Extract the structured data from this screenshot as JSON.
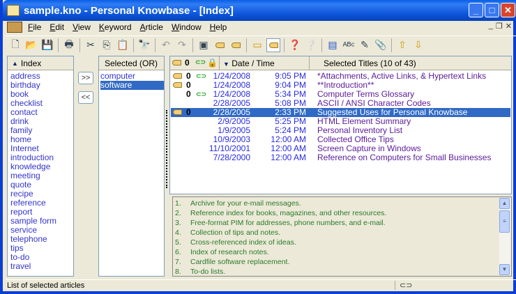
{
  "window": {
    "title": "sample.kno - Personal Knowbase - [Index]"
  },
  "menu": [
    "File",
    "Edit",
    "View",
    "Keyword",
    "Article",
    "Window",
    "Help"
  ],
  "keywords": {
    "header": "Index",
    "items": [
      "address",
      "birthday",
      "book",
      "checklist",
      "contact",
      "drink",
      "family",
      "home",
      "Internet",
      "introduction",
      "knowledge",
      "meeting",
      "quote",
      "recipe",
      "reference",
      "report",
      "sample form",
      "service",
      "telephone",
      "tips",
      "to-do",
      "travel"
    ]
  },
  "buttons": {
    "add": ">>",
    "remove": "<<"
  },
  "selected": {
    "header": "Selected (OR)",
    "items": [
      "computer",
      "software"
    ],
    "selected_index": 1
  },
  "articles": {
    "date_header": "Date / Time",
    "titles_header": "Selected Titles (10 of 43)",
    "rows": [
      {
        "tag": true,
        "clip": true,
        "link": true,
        "date": "1/24/2008",
        "time": "9:05 PM",
        "title": "*Attachments, Active Links, & Hypertext Links"
      },
      {
        "tag": true,
        "clip": true,
        "link": false,
        "date": "1/24/2008",
        "time": "9:04 PM",
        "title": "**Introduction**"
      },
      {
        "tag": false,
        "clip": true,
        "link": true,
        "date": "1/24/2008",
        "time": "5:34 PM",
        "title": "Computer Terms Glossary"
      },
      {
        "tag": false,
        "clip": false,
        "link": false,
        "date": "2/28/2005",
        "time": "5:08 PM",
        "title": "ASCII / ANSI Character Codes"
      },
      {
        "tag": true,
        "clip": true,
        "link": false,
        "date": "2/28/2005",
        "time": "2:33 PM",
        "title": "Suggested Uses for Personal Knowbase",
        "selected": true
      },
      {
        "tag": false,
        "clip": false,
        "link": false,
        "date": "2/9/2005",
        "time": "5:25 PM",
        "title": "HTML Element Summary"
      },
      {
        "tag": false,
        "clip": false,
        "link": false,
        "date": "1/9/2005",
        "time": "5:24 PM",
        "title": "Personal Inventory List"
      },
      {
        "tag": false,
        "clip": false,
        "link": false,
        "date": "10/9/2003",
        "time": "12:00 AM",
        "title": "Collected Office Tips"
      },
      {
        "tag": false,
        "clip": false,
        "link": false,
        "date": "11/10/2001",
        "time": "12:00 AM",
        "title": "Screen Capture in Windows"
      },
      {
        "tag": false,
        "clip": false,
        "link": false,
        "date": "7/28/2000",
        "time": "12:00 AM",
        "title": "Reference on Computers for Small Businesses"
      }
    ]
  },
  "preview": [
    "1.|Archive for your e-mail messages.",
    "2.|Reference index for books, magazines, and other resources.",
    "3.|Free-format PIM for addresses, phone numbers, and e-mail.",
    "4.|Collection of tips and notes.",
    "5.|Cross-referenced index of ideas.",
    "6.|Index of research notes.",
    "7.|Cardfile software replacement.",
    "8.|To-do lists."
  ],
  "status": "List of selected articles"
}
